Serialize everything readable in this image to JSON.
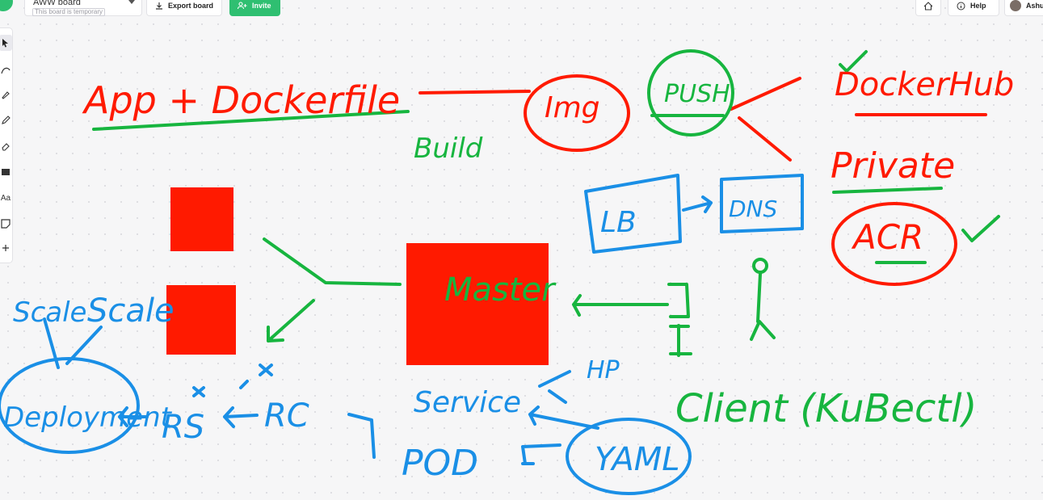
{
  "header": {
    "board_name": "AWW board",
    "board_tag": "This board is temporary",
    "export_label": "Export board",
    "invite_label": "Invite",
    "help_label": "Help",
    "user_label": "Ashu"
  },
  "toolbar": {
    "tools": [
      "select-tool",
      "curve-tool",
      "brush-tool",
      "pencil-tool",
      "eraser-tool",
      "shape-tool",
      "text-tool",
      "sticky-note-tool",
      "add-tool"
    ],
    "text_tool_label": "Aa"
  },
  "canvas": {
    "labels": {
      "app_dockerfile": "App + Dockerfile",
      "build": "Build",
      "img": "Img",
      "push": "PUSH",
      "dockerhub": "DockerHub",
      "private": "Private",
      "acr": "ACR",
      "lb": "LB",
      "dns": "DNS",
      "master": "Master",
      "client": "Client (KuBectl)",
      "scale_a": "Scale",
      "scale_b": "Scale",
      "deployment": "Deployment",
      "rs": "RS",
      "rc": "RC",
      "service": "Service",
      "hp": "HP",
      "pod": "POD",
      "yaml": "YAML"
    },
    "colors": {
      "red": "#ff1a00",
      "green": "#17b53f",
      "blue": "#1a8fe6",
      "square": "#ff1a00"
    }
  }
}
